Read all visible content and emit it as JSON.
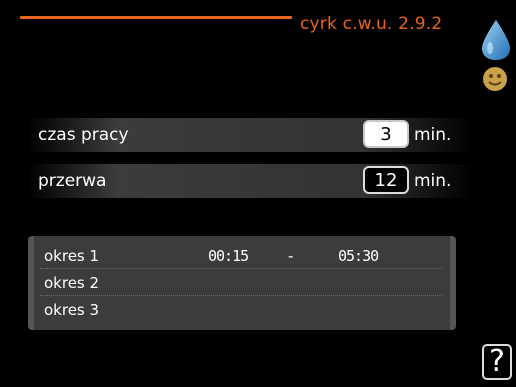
{
  "header": {
    "title": "cyrk c.w.u. 2.9.2",
    "accent_color": "#e8641b",
    "icons": [
      "water-drop-icon",
      "smiley-face-icon"
    ]
  },
  "settings": [
    {
      "label": "czas pracy",
      "value": "3",
      "unit": "min.",
      "selected": true
    },
    {
      "label": "przerwa",
      "value": "12",
      "unit": "min.",
      "selected": false
    }
  ],
  "periods": [
    {
      "label": "okres 1",
      "start": "00:15",
      "separator": "-",
      "end": "05:30"
    },
    {
      "label": "okres 2",
      "start": "",
      "separator": "",
      "end": ""
    },
    {
      "label": "okres 3",
      "start": "",
      "separator": "",
      "end": ""
    }
  ],
  "help": {
    "label": "?",
    "icon": "help-icon"
  }
}
